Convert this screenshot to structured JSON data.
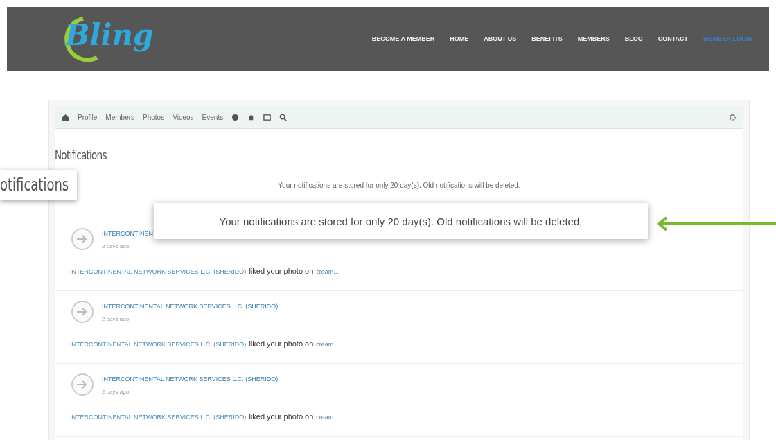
{
  "header": {
    "logo": "Bling",
    "nav": [
      {
        "label": "BECOME A MEMBER",
        "selected": false
      },
      {
        "label": "HOME",
        "selected": false
      },
      {
        "label": "ABOUT US",
        "selected": false
      },
      {
        "label": "BENEFITS",
        "selected": false
      },
      {
        "label": "MEMBERS",
        "selected": false
      },
      {
        "label": "BLOG",
        "selected": false
      },
      {
        "label": "CONTACT",
        "selected": false
      },
      {
        "label": "MEMBER LOGIN",
        "selected": true
      }
    ]
  },
  "toolbar": {
    "tabs": [
      "Profile",
      "Members",
      "Photos",
      "Videos",
      "Events"
    ]
  },
  "heading": "Notifications",
  "info": "Your notifications are stored for only 20 day(s). Old notifications will be deleted.",
  "notifications": [
    {
      "name": "INTERCONTINEN",
      "time": "2 days ago",
      "actor": "INTERCONTINENTAL NETWORK SERVICES L.C. (SHERIDO)",
      "verb": "liked your photo on",
      "target": "cream..."
    },
    {
      "name": "INTERCONTINENTAL NETWORK SERVICES L.C. (SHERIDO)",
      "time": "2 days ago",
      "actor": "INTERCONTINENTAL NETWORK SERVICES L.C. (SHERIDO)",
      "verb": "liked your photo on",
      "target": "cream..."
    },
    {
      "name": "INTERCONTINENTAL NETWORK SERVICES L.C. (SHERIDO)",
      "time": "2 days ago",
      "actor": "INTERCONTINENTAL NETWORK SERVICES L.C. (SHERIDO)",
      "verb": "liked your photo on",
      "target": "cream..."
    }
  ],
  "callouts": [
    {
      "kind": "label",
      "text": "otifications"
    },
    {
      "kind": "banner",
      "text": "Your notifications are stored for only 20 day(s). Old notifications will be deleted."
    }
  ]
}
